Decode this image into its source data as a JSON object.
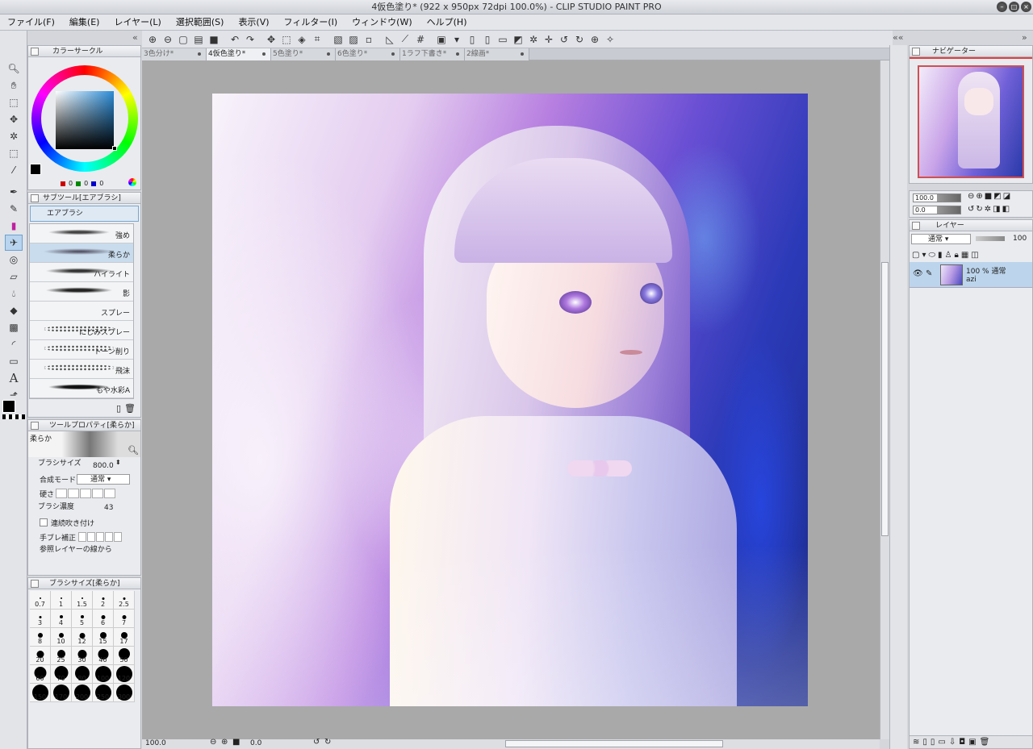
{
  "window": {
    "title": "4仮色塗り* (922 x 950px 72dpi 100.0%) - CLIP STUDIO PAINT PRO"
  },
  "menu": [
    "ファイル(F)",
    "編集(E)",
    "レイヤー(L)",
    "選択範囲(S)",
    "表示(V)",
    "フィルター(I)",
    "ウィンドウ(W)",
    "ヘルプ(H)"
  ],
  "doc_tabs": [
    {
      "label": "3色分け*",
      "active": false
    },
    {
      "label": "4仮色塗り*",
      "active": true
    },
    {
      "label": "5色塗り*",
      "active": false
    },
    {
      "label": "6色塗り*",
      "active": false
    },
    {
      "label": "1ラフ下書き*",
      "active": false
    },
    {
      "label": "2線画*",
      "active": false
    }
  ],
  "color_panel": {
    "title": "カラーサークル",
    "r": "0",
    "g": "0",
    "b": "0",
    "main_color": "#000000",
    "sub_color": "#a8d8f0"
  },
  "subtool_panel": {
    "title": "サブツール[エアブラシ]",
    "group_label": "エアブラシ",
    "brushes": [
      {
        "label": "強め",
        "selected": false,
        "style": "strong"
      },
      {
        "label": "柔らか",
        "selected": true,
        "style": "soft"
      },
      {
        "label": "ハイライト",
        "selected": false,
        "style": "highlight"
      },
      {
        "label": "影",
        "selected": false,
        "style": "shadow"
      },
      {
        "label": "スプレー",
        "selected": false,
        "style": "none"
      },
      {
        "label": "にじみスプレー",
        "selected": false,
        "style": "spray"
      },
      {
        "label": "トーン削り",
        "selected": false,
        "style": "spray"
      },
      {
        "label": "飛沫",
        "selected": false,
        "style": "spray"
      },
      {
        "label": "もや水彩A",
        "selected": false,
        "style": "mist"
      }
    ]
  },
  "toolprop_panel": {
    "title": "ツールプロパティ[柔らか]",
    "preview_label": "柔らか",
    "brush_size_label": "ブラシサイズ",
    "brush_size_value": "800.0",
    "blend_mode_label": "合成モード",
    "blend_mode_value": "通常",
    "hardness_label": "硬さ",
    "density_label": "ブラシ濃度",
    "density_value": "43",
    "continuous_label": "連続吹き付け",
    "stabilize_label": "手ブレ補正",
    "ref_label": "参照レイヤーの線から"
  },
  "brushsize_panel": {
    "title": "ブラシサイズ[柔らか]",
    "sizes": [
      "0.7",
      "1",
      "1.5",
      "2",
      "2.5",
      "3",
      "4",
      "5",
      "6",
      "7",
      "8",
      "10",
      "12",
      "15",
      "17",
      "20",
      "25",
      "30",
      "40",
      "50",
      "60",
      "70",
      "80",
      "100",
      "120",
      "150",
      "170",
      "200",
      "250",
      "300"
    ]
  },
  "navigator": {
    "title": "ナビゲーター",
    "zoom": "100.0",
    "rotate": "0.0"
  },
  "layer_panel": {
    "title": "レイヤー",
    "blend_mode": "通常",
    "opacity": "100",
    "layers": [
      {
        "opacity_mode": "100 % 通常",
        "name": "azi"
      }
    ]
  },
  "status": {
    "zoom": "100.0",
    "rotate": "0.0"
  },
  "colors": {
    "accent": "#6ea0d0",
    "selected_row": "#c9dcee"
  }
}
